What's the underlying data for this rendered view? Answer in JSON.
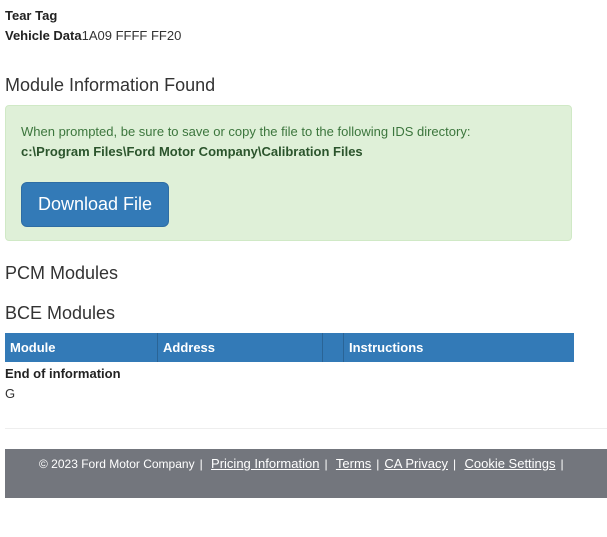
{
  "header": {
    "tear_tag_label": "Tear Tag",
    "vehicle_data_label": "Vehicle Data",
    "vehicle_data_value": "1A09 FFFF FF20"
  },
  "module_info": {
    "title": "Module Information Found",
    "alert_message": "When prompted, be sure to save or copy the file to the following IDS directory:",
    "directory_path": "c:\\Program Files\\Ford Motor Company\\Calibration Files",
    "download_button_label": "Download File"
  },
  "pcm": {
    "title": "PCM Modules"
  },
  "bce": {
    "title": "BCE Modules",
    "columns": [
      "Module",
      "Address",
      "",
      "Instructions"
    ]
  },
  "end_of_information": "End of information",
  "trailing_text": "G",
  "footer": {
    "copyright": "© 2023 Ford Motor Company",
    "links": [
      "Pricing Information",
      "Terms",
      "CA Privacy",
      "Cookie Settings"
    ]
  },
  "colors": {
    "primary": "#337ab7",
    "alert_bg": "#dff0d8",
    "alert_text": "#3c763d",
    "footer_bg": "#73767d"
  }
}
